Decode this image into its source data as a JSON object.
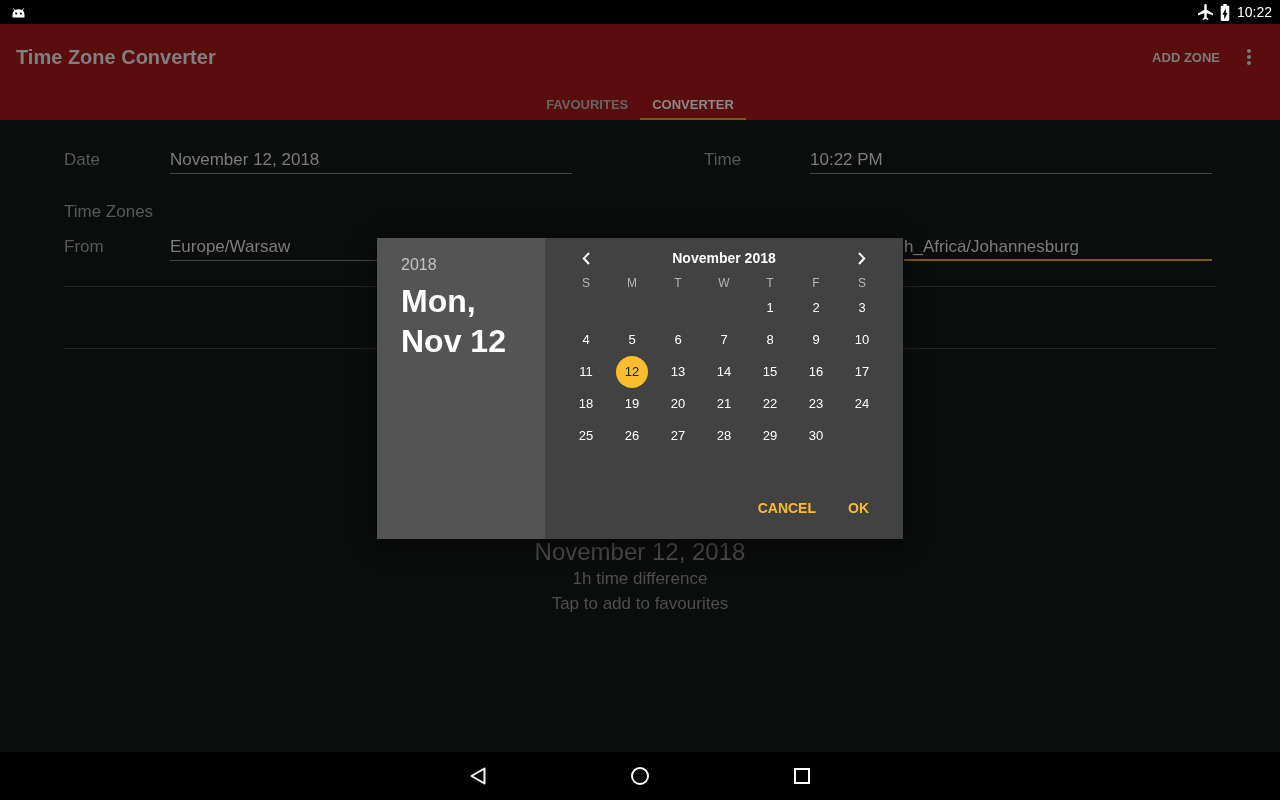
{
  "status_bar": {
    "time": "10:22"
  },
  "app_bar": {
    "title": "Time Zone Converter",
    "actions": [
      {
        "label": "ADD ZONE"
      }
    ]
  },
  "tabs": [
    {
      "label": "FAVOURITES",
      "selected": false
    },
    {
      "label": "CONVERTER",
      "selected": true
    }
  ],
  "form": {
    "date": {
      "label": "Date",
      "value": "November 12, 2018"
    },
    "time": {
      "label": "Time",
      "value": "10:22 PM"
    },
    "zones_heading": "Time Zones",
    "from": {
      "label": "From",
      "value": "Europe/Warsaw"
    },
    "to": {
      "value": "h_Africa/Johannesburg",
      "focused": true
    }
  },
  "result": {
    "date": "November 12, 2018",
    "difference": "1h time difference",
    "hint": "Tap to add to favourites"
  },
  "date_picker": {
    "year": "2018",
    "date": "Mon, Nov 12",
    "month": "November 2018",
    "weekdays": [
      "S",
      "M",
      "T",
      "W",
      "T",
      "F",
      "S"
    ],
    "weeks": [
      [
        {
          "day": "1",
          "selected": false
        },
        {
          "day": "2",
          "selected": false
        },
        {
          "day": "3",
          "selected": false
        }
      ],
      [
        {
          "day": "4",
          "selected": false
        },
        {
          "day": "5",
          "selected": false
        },
        {
          "day": "6",
          "selected": false
        },
        {
          "day": "7",
          "selected": false
        },
        {
          "day": "8",
          "selected": false
        },
        {
          "day": "9",
          "selected": false
        },
        {
          "day": "10",
          "selected": false
        }
      ],
      [
        {
          "day": "11",
          "selected": false
        },
        {
          "day": "12",
          "selected": true
        },
        {
          "day": "13",
          "selected": false
        },
        {
          "day": "14",
          "selected": false
        },
        {
          "day": "15",
          "selected": false
        },
        {
          "day": "16",
          "selected": false
        },
        {
          "day": "17",
          "selected": false
        }
      ],
      [
        {
          "day": "18",
          "selected": false
        },
        {
          "day": "19",
          "selected": false
        },
        {
          "day": "20",
          "selected": false
        },
        {
          "day": "21",
          "selected": false
        },
        {
          "day": "22",
          "selected": false
        },
        {
          "day": "23",
          "selected": false
        },
        {
          "day": "24",
          "selected": false
        }
      ],
      [
        {
          "day": "25",
          "selected": false
        },
        {
          "day": "26",
          "selected": false
        },
        {
          "day": "27",
          "selected": false
        },
        {
          "day": "28",
          "selected": false
        },
        {
          "day": "29",
          "selected": false
        },
        {
          "day": "30",
          "selected": false
        }
      ]
    ],
    "buttons": [
      {
        "label": "CANCEL"
      },
      {
        "label": "OK"
      }
    ]
  }
}
